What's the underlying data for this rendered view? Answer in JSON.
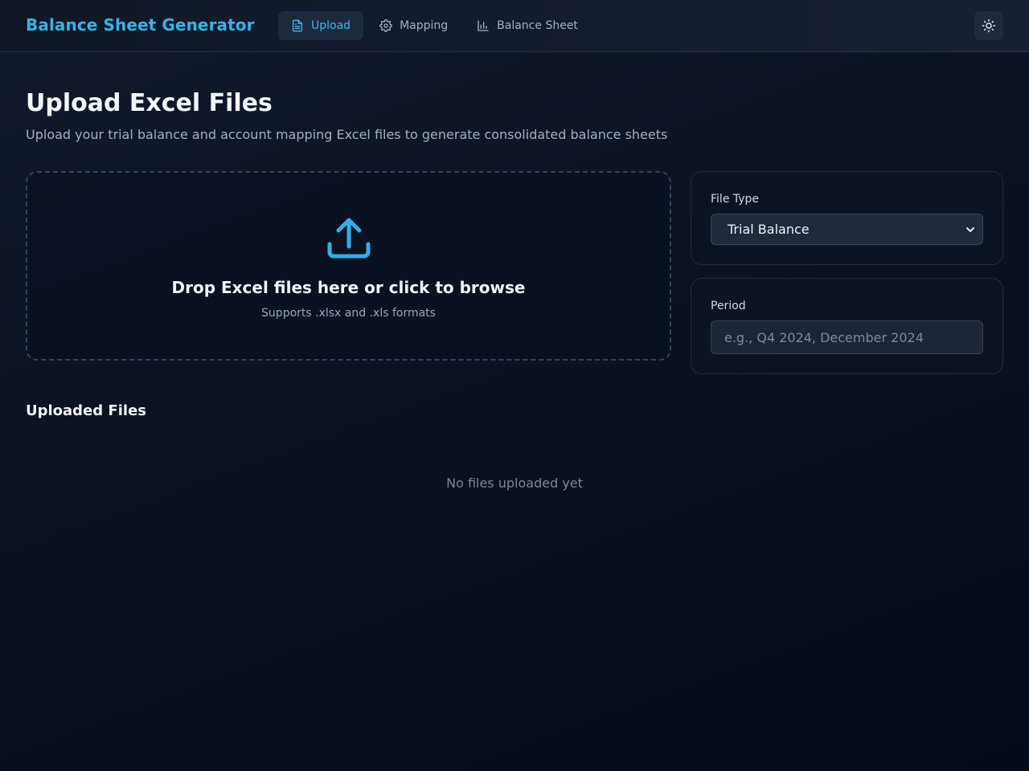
{
  "app": {
    "title": "Balance Sheet Generator"
  },
  "nav": {
    "items": [
      {
        "label": "Upload",
        "icon": "file-text-icon",
        "active": true
      },
      {
        "label": "Mapping",
        "icon": "gear-icon",
        "active": false
      },
      {
        "label": "Balance Sheet",
        "icon": "bar-chart-icon",
        "active": false
      }
    ],
    "theme_toggle_icon": "sun-icon"
  },
  "page": {
    "title": "Upload Excel Files",
    "subtitle": "Upload your trial balance and account mapping Excel files to generate consolidated balance sheets"
  },
  "dropzone": {
    "icon": "upload-icon",
    "title": "Drop Excel files here or click to browse",
    "subtitle": "Supports .xlsx and .xls formats"
  },
  "file_type": {
    "label": "File Type",
    "selected": "Trial Balance"
  },
  "period": {
    "label": "Period",
    "value": "",
    "placeholder": "e.g., Q4 2024, December 2024"
  },
  "uploaded": {
    "title": "Uploaded Files",
    "empty_text": "No files uploaded yet"
  },
  "colors": {
    "accent": "#35b4e8",
    "background": "#0b1222",
    "card": "#0d1424",
    "border": "#222d40"
  }
}
